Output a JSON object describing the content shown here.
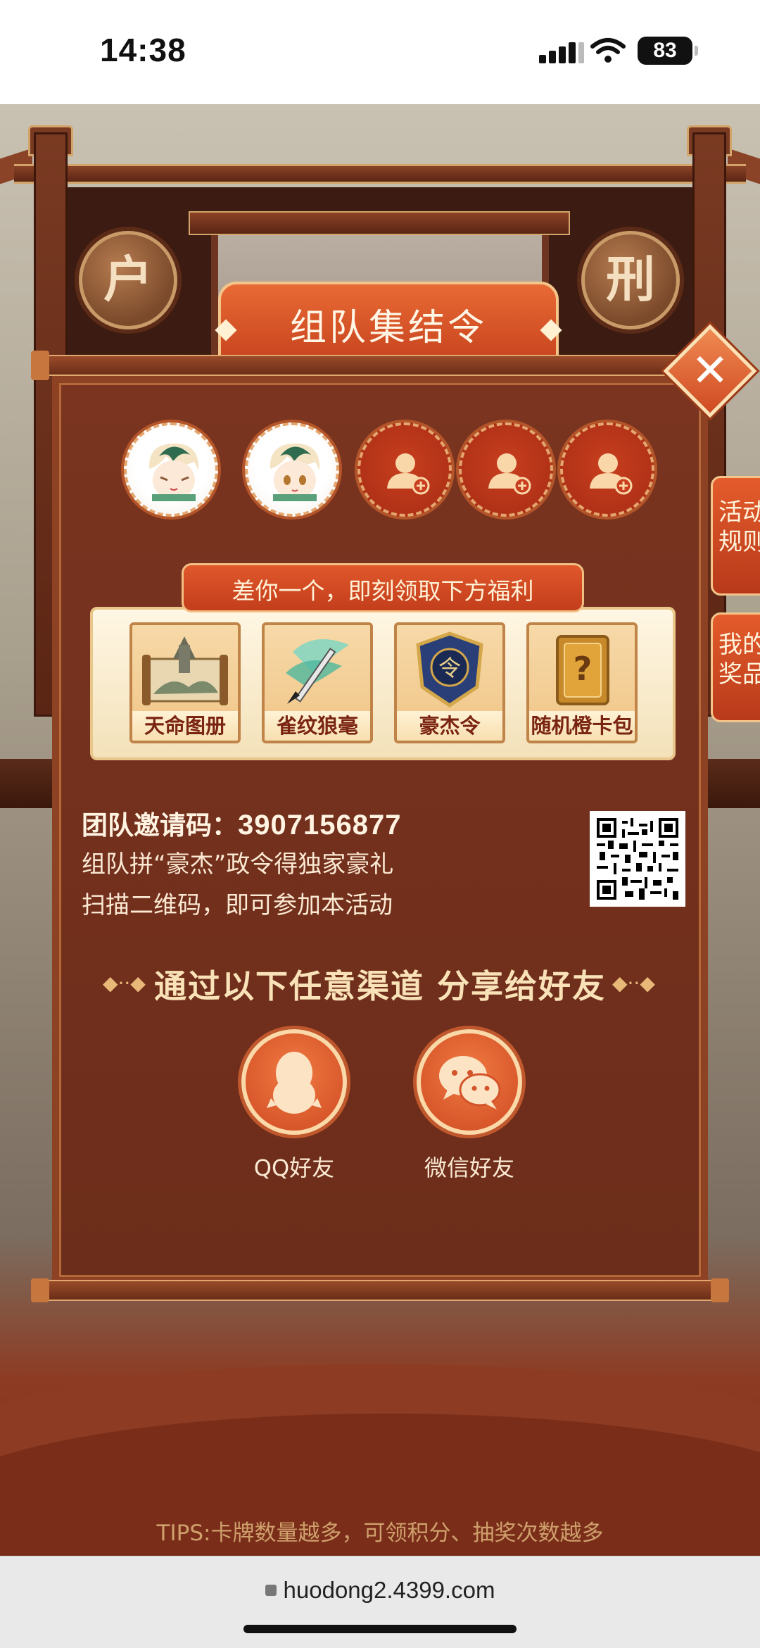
{
  "status_bar": {
    "time": "14:38",
    "battery": "83"
  },
  "background": {
    "banner_title": "组队集结令",
    "medal_left": "户",
    "medal_right": "刑",
    "side_button_rules": "活动\n规则",
    "side_button_prizes": "我的\n奖品",
    "tips": "TIPS:卡牌数量越多，可领积分、抽奖次数越多"
  },
  "modal": {
    "close_symbol": "✕",
    "team_slots": [
      {
        "state": "filled",
        "name": "teammate-1"
      },
      {
        "state": "filled",
        "name": "teammate-2"
      },
      {
        "state": "empty"
      },
      {
        "state": "empty"
      },
      {
        "state": "empty"
      }
    ],
    "benefit_banner": "差你一个，即刻领取下方福利",
    "rewards": [
      {
        "label": "天命图册",
        "icon": "scroll-icon"
      },
      {
        "label": "雀纹狼毫",
        "icon": "brush-icon"
      },
      {
        "label": "豪杰令",
        "icon": "token-icon"
      },
      {
        "label": "随机橙卡包",
        "icon": "card-pack-icon"
      }
    ],
    "invite_label": "团队邀请码：",
    "invite_code": "3907156877",
    "desc_line1": "组队拼“豪杰”政令得独家豪礼",
    "desc_line2": "扫描二维码，即可参加本活动",
    "share_title": "通过以下任意渠道 分享给好友",
    "share_options": [
      {
        "label": "QQ好友",
        "icon": "qq-penguin-icon"
      },
      {
        "label": "微信好友",
        "icon": "wechat-icon"
      }
    ]
  },
  "browser": {
    "url": "huodong2.4399.com"
  },
  "colors": {
    "modal_bg": "#6c2d1a",
    "accent_orange": "#cf4a22",
    "gold": "#f4c58a"
  }
}
